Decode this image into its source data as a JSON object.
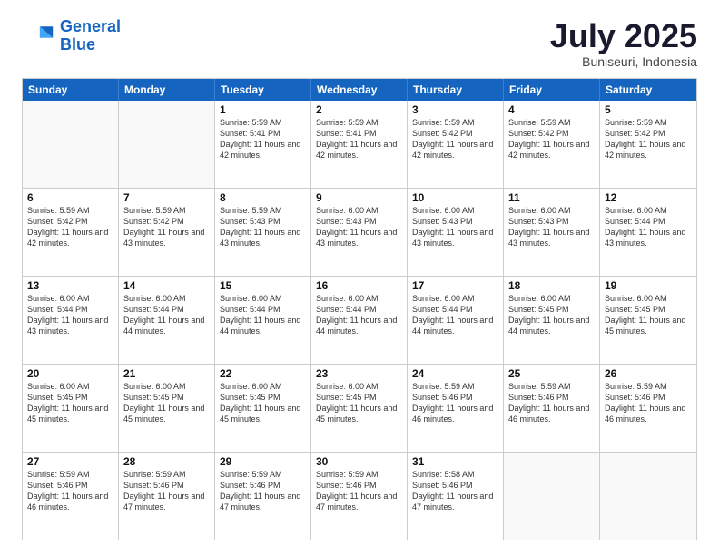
{
  "logo": {
    "line1": "General",
    "line2": "Blue"
  },
  "title": "July 2025",
  "subtitle": "Buniseuri, Indonesia",
  "headers": [
    "Sunday",
    "Monday",
    "Tuesday",
    "Wednesday",
    "Thursday",
    "Friday",
    "Saturday"
  ],
  "rows": [
    [
      {
        "day": "",
        "text": ""
      },
      {
        "day": "",
        "text": ""
      },
      {
        "day": "1",
        "text": "Sunrise: 5:59 AM\nSunset: 5:41 PM\nDaylight: 11 hours and 42 minutes."
      },
      {
        "day": "2",
        "text": "Sunrise: 5:59 AM\nSunset: 5:41 PM\nDaylight: 11 hours and 42 minutes."
      },
      {
        "day": "3",
        "text": "Sunrise: 5:59 AM\nSunset: 5:42 PM\nDaylight: 11 hours and 42 minutes."
      },
      {
        "day": "4",
        "text": "Sunrise: 5:59 AM\nSunset: 5:42 PM\nDaylight: 11 hours and 42 minutes."
      },
      {
        "day": "5",
        "text": "Sunrise: 5:59 AM\nSunset: 5:42 PM\nDaylight: 11 hours and 42 minutes."
      }
    ],
    [
      {
        "day": "6",
        "text": "Sunrise: 5:59 AM\nSunset: 5:42 PM\nDaylight: 11 hours and 42 minutes."
      },
      {
        "day": "7",
        "text": "Sunrise: 5:59 AM\nSunset: 5:42 PM\nDaylight: 11 hours and 43 minutes."
      },
      {
        "day": "8",
        "text": "Sunrise: 5:59 AM\nSunset: 5:43 PM\nDaylight: 11 hours and 43 minutes."
      },
      {
        "day": "9",
        "text": "Sunrise: 6:00 AM\nSunset: 5:43 PM\nDaylight: 11 hours and 43 minutes."
      },
      {
        "day": "10",
        "text": "Sunrise: 6:00 AM\nSunset: 5:43 PM\nDaylight: 11 hours and 43 minutes."
      },
      {
        "day": "11",
        "text": "Sunrise: 6:00 AM\nSunset: 5:43 PM\nDaylight: 11 hours and 43 minutes."
      },
      {
        "day": "12",
        "text": "Sunrise: 6:00 AM\nSunset: 5:44 PM\nDaylight: 11 hours and 43 minutes."
      }
    ],
    [
      {
        "day": "13",
        "text": "Sunrise: 6:00 AM\nSunset: 5:44 PM\nDaylight: 11 hours and 43 minutes."
      },
      {
        "day": "14",
        "text": "Sunrise: 6:00 AM\nSunset: 5:44 PM\nDaylight: 11 hours and 44 minutes."
      },
      {
        "day": "15",
        "text": "Sunrise: 6:00 AM\nSunset: 5:44 PM\nDaylight: 11 hours and 44 minutes."
      },
      {
        "day": "16",
        "text": "Sunrise: 6:00 AM\nSunset: 5:44 PM\nDaylight: 11 hours and 44 minutes."
      },
      {
        "day": "17",
        "text": "Sunrise: 6:00 AM\nSunset: 5:44 PM\nDaylight: 11 hours and 44 minutes."
      },
      {
        "day": "18",
        "text": "Sunrise: 6:00 AM\nSunset: 5:45 PM\nDaylight: 11 hours and 44 minutes."
      },
      {
        "day": "19",
        "text": "Sunrise: 6:00 AM\nSunset: 5:45 PM\nDaylight: 11 hours and 45 minutes."
      }
    ],
    [
      {
        "day": "20",
        "text": "Sunrise: 6:00 AM\nSunset: 5:45 PM\nDaylight: 11 hours and 45 minutes."
      },
      {
        "day": "21",
        "text": "Sunrise: 6:00 AM\nSunset: 5:45 PM\nDaylight: 11 hours and 45 minutes."
      },
      {
        "day": "22",
        "text": "Sunrise: 6:00 AM\nSunset: 5:45 PM\nDaylight: 11 hours and 45 minutes."
      },
      {
        "day": "23",
        "text": "Sunrise: 6:00 AM\nSunset: 5:45 PM\nDaylight: 11 hours and 45 minutes."
      },
      {
        "day": "24",
        "text": "Sunrise: 5:59 AM\nSunset: 5:46 PM\nDaylight: 11 hours and 46 minutes."
      },
      {
        "day": "25",
        "text": "Sunrise: 5:59 AM\nSunset: 5:46 PM\nDaylight: 11 hours and 46 minutes."
      },
      {
        "day": "26",
        "text": "Sunrise: 5:59 AM\nSunset: 5:46 PM\nDaylight: 11 hours and 46 minutes."
      }
    ],
    [
      {
        "day": "27",
        "text": "Sunrise: 5:59 AM\nSunset: 5:46 PM\nDaylight: 11 hours and 46 minutes."
      },
      {
        "day": "28",
        "text": "Sunrise: 5:59 AM\nSunset: 5:46 PM\nDaylight: 11 hours and 47 minutes."
      },
      {
        "day": "29",
        "text": "Sunrise: 5:59 AM\nSunset: 5:46 PM\nDaylight: 11 hours and 47 minutes."
      },
      {
        "day": "30",
        "text": "Sunrise: 5:59 AM\nSunset: 5:46 PM\nDaylight: 11 hours and 47 minutes."
      },
      {
        "day": "31",
        "text": "Sunrise: 5:58 AM\nSunset: 5:46 PM\nDaylight: 11 hours and 47 minutes."
      },
      {
        "day": "",
        "text": ""
      },
      {
        "day": "",
        "text": ""
      }
    ]
  ]
}
